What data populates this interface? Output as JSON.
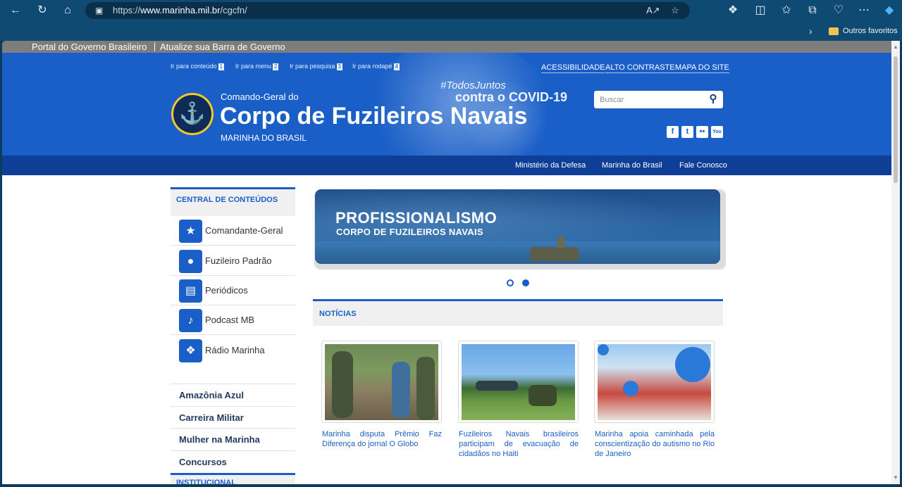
{
  "browser": {
    "url_prefix": "https://",
    "url_host": "www.marinha.mil.br",
    "url_path": "/cgcfn/",
    "favorites_label": "Outros favoritos"
  },
  "govbar": {
    "portal": "Portal do Governo Brasileiro",
    "update": "Atualize sua Barra de Governo"
  },
  "header": {
    "skip_links": [
      {
        "label": "Ir para conteúdo",
        "key": "1"
      },
      {
        "label": "Ir para menu",
        "key": "2"
      },
      {
        "label": "Ir para pesquisa",
        "key": "3"
      },
      {
        "label": "Ir para rodapé",
        "key": "4"
      }
    ],
    "utility_links": [
      "ACESSIBILIDADE",
      "ALTO CONTRASTE",
      "MAPA DO SITE"
    ],
    "supertitle": "Comando-Geral do",
    "title": "Corpo de Fuzileiros Navais",
    "subtitle": "MARINHA DO BRASIL",
    "covid_tag": "#TodosJuntos",
    "covid_line": "contra o COVID-19",
    "search_placeholder": "Buscar",
    "social": [
      "facebook-icon",
      "twitter-icon",
      "flickr-icon",
      "youtube-icon"
    ]
  },
  "nav": {
    "links": [
      "Ministério da Defesa",
      "Marinha do Brasil",
      "Fale Conosco"
    ]
  },
  "sidebar": {
    "heading": "CENTRAL DE CONTEÚDOS",
    "items": [
      {
        "label": "Comandante-Geral",
        "icon": "stars-icon"
      },
      {
        "label": "Fuzileiro Padrão",
        "icon": "profile-icon"
      },
      {
        "label": "Periódicos",
        "icon": "book-icon"
      },
      {
        "label": "Podcast MB",
        "icon": "microphone-icon"
      },
      {
        "label": "Rádio Marinha",
        "icon": "radio-tower-icon"
      }
    ],
    "links": [
      "Amazônia Azul",
      "Carreira Militar",
      "Mulher na Marinha",
      "Concursos"
    ],
    "next_heading": "INSTITUCIONAL"
  },
  "banner": {
    "title": "PROFISSIONALISMO",
    "subtitle": "CORPO DE FUZILEIROS NAVAIS",
    "slides": 2,
    "active_slide": 2
  },
  "news": {
    "heading": "NOTÍCIAS",
    "items": [
      {
        "caption": "Marinha disputa Prêmio Faz Diferença do jornal O Globo"
      },
      {
        "caption": "Fuzileiros Navais brasileiros participam de evacuação de cidadãos no Haiti"
      },
      {
        "caption": "Marinha apoia caminhada pela conscientização do autismo no Rio de Janeiro"
      }
    ]
  },
  "colors": {
    "brand_blue": "#1a5fc8",
    "nav_blue": "#0e3e95",
    "gov_gray": "#7d7d7d"
  }
}
